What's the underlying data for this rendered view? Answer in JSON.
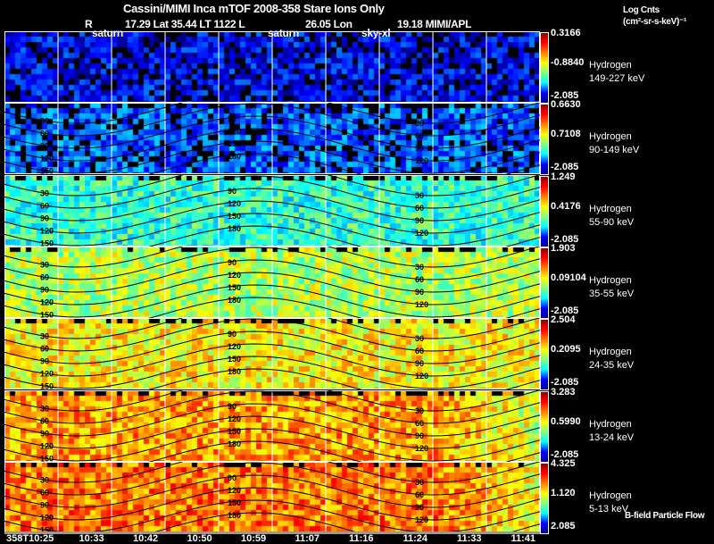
{
  "header": {
    "title": "Cassini/MIMI Inca mTOF  2008-358   Stare   Ions Only",
    "r_label": "R",
    "ephemeris": "17.29 Lat 35.44 LT 1122 L",
    "lon": "26.05 Lon",
    "lon_value": "19.18  MIMI/APL",
    "markers": [
      "saturn",
      "saturn",
      "sky-xl"
    ]
  },
  "colorbar_title": {
    "line1": "Log Cnts",
    "line2": "(cm²-sr-s-keV)⁻¹"
  },
  "footer_note": "B-field Particle Flow",
  "colors": {
    "background": "#000000",
    "grid": "#ffffff",
    "contour": "#000000",
    "colormap": "jet"
  },
  "chart_data": {
    "type": "heatmap",
    "x_tick_labels": [
      "358T10:25",
      "10:33",
      "10:42",
      "10:50",
      "10:59",
      "11:07",
      "11:16",
      "11:24",
      "11:33",
      "11:41"
    ],
    "contour_levels": [
      "30",
      "60",
      "90",
      "120",
      "150",
      "180"
    ],
    "panels": [
      {
        "species": "Hydrogen",
        "energy": "149-227 keV",
        "cmax": "0.3166",
        "cmid": "-0.8840",
        "cmin": "-2.085",
        "level": 0.12
      },
      {
        "species": "Hydrogen",
        "energy": "90-149 keV",
        "cmax": "0.6630",
        "cmid": "0.7108",
        "cmin": "-2.085",
        "level": 0.22
      },
      {
        "species": "Hydrogen",
        "energy": "55-90 keV",
        "cmax": "1.249",
        "cmid": "0.4176",
        "cmin": "-2.085",
        "level": 0.42
      },
      {
        "species": "Hydrogen",
        "energy": "35-55 keV",
        "cmax": "1.903",
        "cmid": "0.09104",
        "cmin": "-2.085",
        "level": 0.55
      },
      {
        "species": "Hydrogen",
        "energy": "24-35 keV",
        "cmax": "2.504",
        "cmid": "0.2095",
        "cmin": "-2.085",
        "level": 0.63
      },
      {
        "species": "Hydrogen",
        "energy": "13-24 keV",
        "cmax": "3.283",
        "cmid": "0.5990",
        "cmin": "-2.085",
        "level": 0.72
      },
      {
        "species": "Hydrogen",
        "energy": "5-13 keV",
        "cmax": "4.325",
        "cmid": "1.120",
        "cmin": "2.085",
        "level": 0.76
      }
    ]
  }
}
